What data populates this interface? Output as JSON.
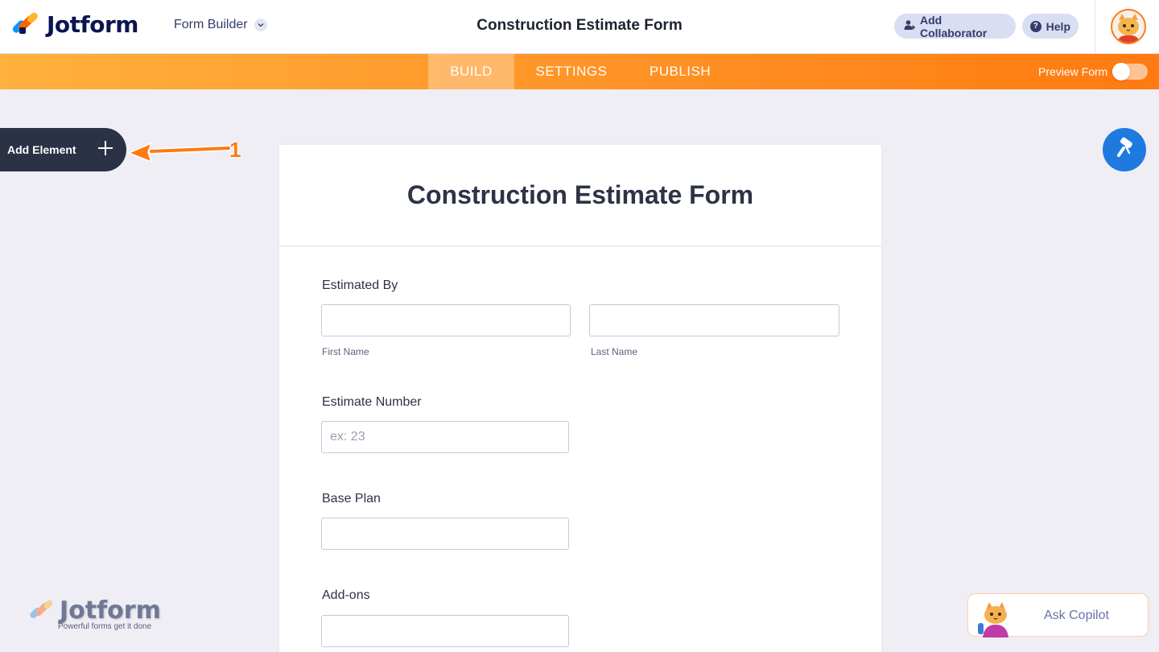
{
  "header": {
    "logo_text": "Jotform",
    "builder_select": "Form Builder",
    "title": "Construction Estimate Form",
    "add_collaborator": "Add Collaborator",
    "help": "Help"
  },
  "nav": {
    "tabs": [
      {
        "label": "BUILD",
        "active": true
      },
      {
        "label": "SETTINGS",
        "active": false
      },
      {
        "label": "PUBLISH",
        "active": false
      }
    ],
    "preview_label": "Preview Form",
    "preview_enabled": false
  },
  "sidebar": {
    "add_element": "Add Element",
    "annotation_number": "1"
  },
  "form": {
    "title": "Construction Estimate Form",
    "fields": [
      {
        "label": "Estimated By",
        "sublabels": [
          "First Name",
          "Last Name"
        ]
      },
      {
        "label": "Estimate Number",
        "placeholder": "ex: 23"
      },
      {
        "label": "Base Plan"
      },
      {
        "label": "Add-ons"
      }
    ]
  },
  "watermark": {
    "brand": "Jotform",
    "tagline": "Powerful forms get it done"
  },
  "copilot": {
    "label": "Ask Copilot"
  },
  "colors": {
    "accent_orange": "#ff7a10",
    "dark_navy": "#0a1551",
    "designer_blue": "#1f7ae0"
  },
  "icons": [
    "user-plus-icon",
    "help-icon",
    "chevron-down-icon",
    "plus-icon",
    "paint-roller-icon",
    "arrow-annotation-icon"
  ]
}
